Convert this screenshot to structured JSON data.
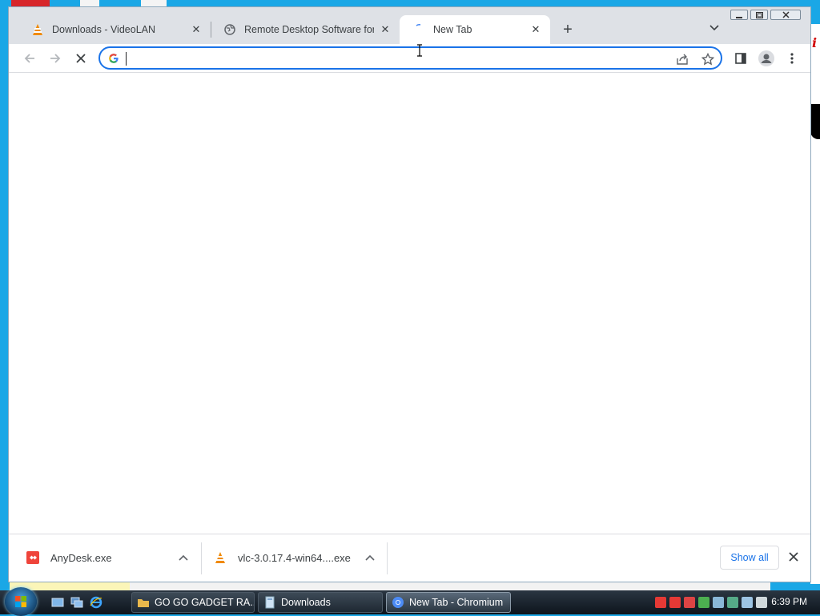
{
  "browser": {
    "tabs": [
      {
        "title": "Downloads - VideoLAN",
        "favicon": "vlc-cone-icon",
        "active": false
      },
      {
        "title": "Remote Desktop Software for Wi",
        "favicon": "globe-icon",
        "active": false
      },
      {
        "title": "New Tab",
        "favicon": "loading-spinner-icon",
        "active": true
      }
    ],
    "new_tab_label": "+",
    "omnibox": {
      "value": "",
      "placeholder": ""
    },
    "toolbar_icons": [
      "back-arrow-icon",
      "forward-arrow-icon",
      "stop-loading-icon",
      "google-g-icon",
      "share-icon",
      "star-icon",
      "side-panel-icon",
      "profile-icon",
      "menu-kebab-icon"
    ]
  },
  "downloads": {
    "items": [
      {
        "name": "AnyDesk.exe",
        "icon": "anydesk-icon"
      },
      {
        "name": "vlc-3.0.17.4-win64....exe",
        "icon": "vlc-cone-icon"
      }
    ],
    "show_all_label": "Show all"
  },
  "taskbar": {
    "tasks": [
      {
        "label": "GO GO GADGET RA...",
        "icon": "folder-icon"
      },
      {
        "label": "Downloads",
        "icon": "window-icon"
      },
      {
        "label": "New Tab - Chromium",
        "icon": "chromium-icon"
      }
    ],
    "clock": "6:39 PM"
  },
  "colors": {
    "desktop": "#1aa7e6",
    "accent": "#1a73e8",
    "tabstrip": "#dee1e6"
  }
}
